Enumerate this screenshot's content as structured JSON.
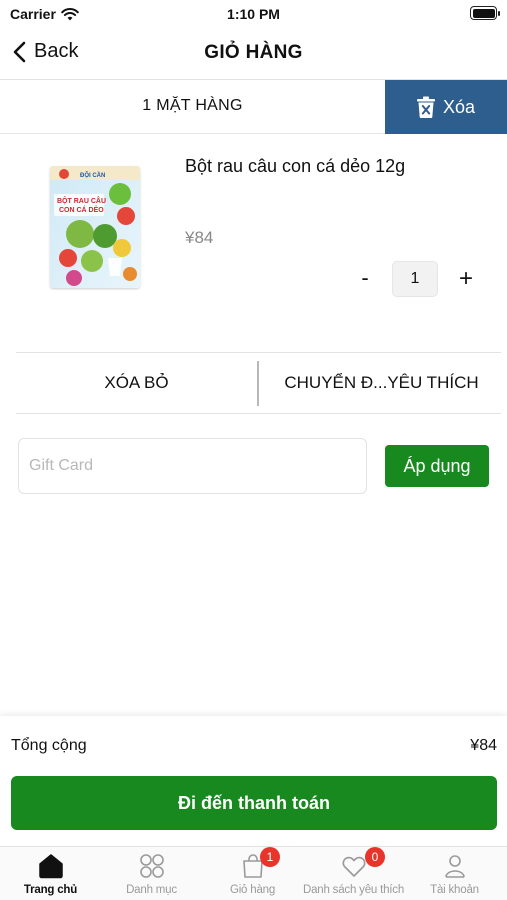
{
  "status_bar": {
    "carrier": "Carrier",
    "time": "1:10 PM"
  },
  "nav": {
    "back_label": "Back",
    "title": "GIỎ HÀNG"
  },
  "cart": {
    "item_count_label": "1 MẶT HÀNG",
    "clear_label": "Xóa"
  },
  "product": {
    "name": "Bột rau câu con cá dẻo 12g",
    "price": "¥84",
    "quantity": "1",
    "minus_label": "-",
    "plus_label": "+",
    "package_brand": "ĐỘI CẦN",
    "package_text_line1": "BỘT RAU CÂU",
    "package_text_line2": "CON CÁ DẺO"
  },
  "actions": {
    "remove_label": "XÓA BỎ",
    "move_to_wishlist_label": "CHUYỂN Đ...YÊU THÍCH"
  },
  "gift_card": {
    "placeholder": "Gift Card",
    "value": "",
    "apply_label": "Áp dụng"
  },
  "summary": {
    "total_label": "Tổng cộng",
    "total_value": "¥84",
    "checkout_label": "Đi đến thanh toán"
  },
  "tab_bar": {
    "tabs": [
      {
        "label": "Trang chủ",
        "icon": "home-icon",
        "active": true
      },
      {
        "label": "Danh mục",
        "icon": "grid-icon",
        "active": false
      },
      {
        "label": "Giỏ hàng",
        "icon": "bag-icon",
        "badge": "1",
        "active": false
      },
      {
        "label": "Danh sách yêu thích",
        "icon": "heart-icon",
        "badge": "0",
        "active": false
      },
      {
        "label": "Tài khoản",
        "icon": "user-icon",
        "active": false
      }
    ]
  },
  "colors": {
    "primary_green": "#17891f",
    "clear_blue": "#2d5e8e",
    "badge_red": "#e8352b"
  }
}
